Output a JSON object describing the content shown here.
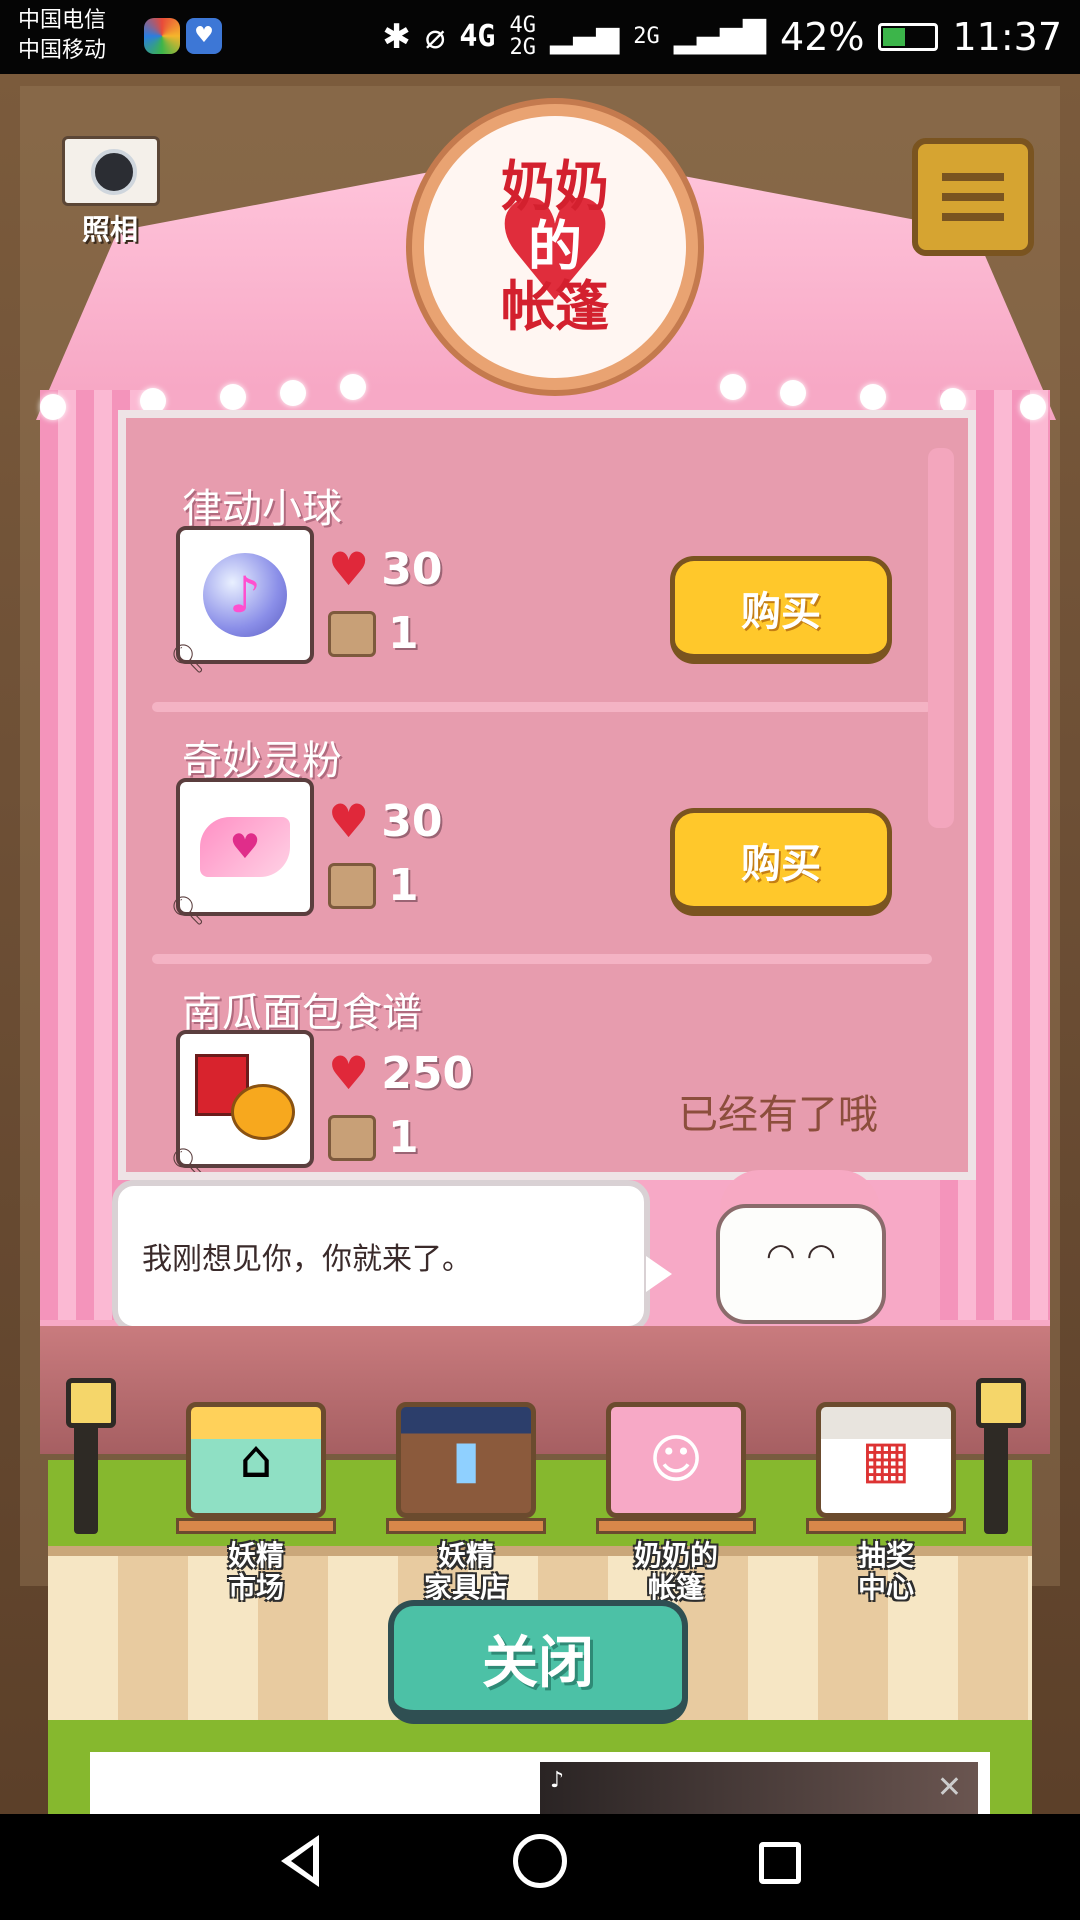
{
  "status_bar": {
    "carrier_1": "中国电信",
    "carrier_2": "中国移动",
    "network_1": "4G",
    "network_2": "4G",
    "network_3": "2G",
    "network_4": "2G",
    "battery": "42%",
    "time": "11:37"
  },
  "header": {
    "title_line1": "奶奶",
    "title_line2": "的",
    "title_line3": "帐篷",
    "camera_label": "照相"
  },
  "shop_items": [
    {
      "name": "律动小球",
      "hearts": "30",
      "boxes": "1",
      "action": "购买",
      "icon": "rhythm-ball-icon"
    },
    {
      "name": "奇妙灵粉",
      "hearts": "30",
      "boxes": "1",
      "action": "购买",
      "icon": "magic-powder-icon"
    },
    {
      "name": "南瓜面包食谱",
      "hearts": "250",
      "boxes": "1",
      "action": "已经有了哦",
      "icon": "pumpkin-bread-recipe-icon"
    }
  ],
  "dialog": {
    "text": "我刚想见你，你就来了。"
  },
  "shops": [
    {
      "label": "妖精\n市场",
      "icon": "fairy-market-icon"
    },
    {
      "label": "妖精\n家具店",
      "icon": "fairy-furniture-store-icon"
    },
    {
      "label": "奶奶的\n帐篷",
      "icon": "grandma-tent-icon"
    },
    {
      "label": "抽奖\n中心",
      "icon": "lottery-center-icon"
    }
  ],
  "close_button": "关闭",
  "colors": {
    "tent_pink": "#f7a9c6",
    "panel_pink": "#e79cae",
    "buy_yellow": "#ffc82b",
    "close_teal": "#4cc1a6",
    "heart_red": "#e0283a"
  }
}
